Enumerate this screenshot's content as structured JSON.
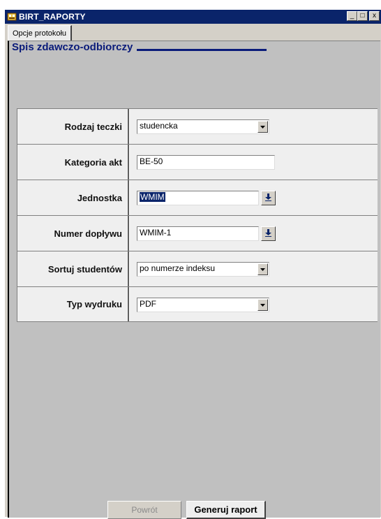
{
  "window": {
    "title": "BIRT_RAPORTY",
    "minimize_label": "_",
    "maximize_label": "□",
    "close_label": "x"
  },
  "tabs": [
    {
      "label": "Opcje protokołu",
      "active": true
    }
  ],
  "page": {
    "title": "Spis zdawczo-odbiorczy"
  },
  "form": {
    "rows": [
      {
        "label": "Rodzaj teczki",
        "value": "studencka",
        "control": "select"
      },
      {
        "label": "Kategoria akt",
        "value": "BE-50",
        "control": "text"
      },
      {
        "label": "Jednostka",
        "value": "WMIM",
        "control": "picker",
        "selected": true
      },
      {
        "label": "Numer dopływu",
        "value": "WMIM-1",
        "control": "picker"
      },
      {
        "label": "Sortuj studentów",
        "value": "po numerze indeksu",
        "control": "select"
      },
      {
        "label": "Typ wydruku",
        "value": "PDF",
        "control": "select"
      }
    ]
  },
  "buttons": {
    "back_label": "Powrót",
    "generate_label": "Generuj raport"
  },
  "colors": {
    "titlebar": "#0a246a",
    "title_text": "#0a1b7a",
    "panel_bg": "#c0c0c0",
    "row_bg": "#efefef"
  },
  "icons": {
    "app": "app-icon",
    "select_arrow": "chevron-down-icon",
    "picker": "download-arrow-icon"
  }
}
